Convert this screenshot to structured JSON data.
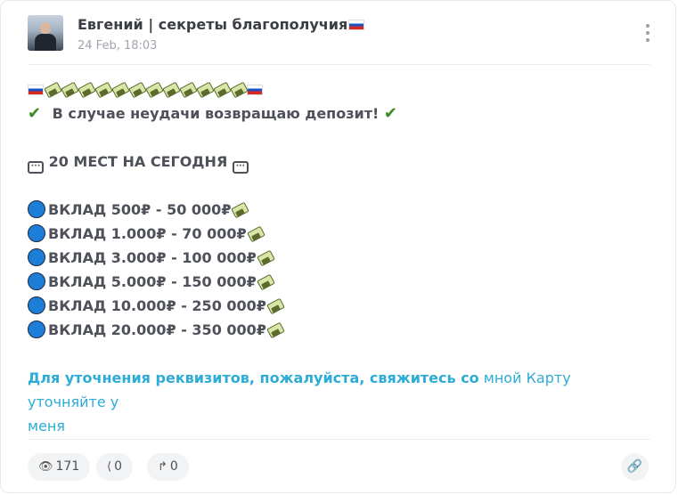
{
  "post": {
    "author": "Евгений | секреты благополучия",
    "date": "24 Feb, 18:03",
    "line_refund": "В случае неудачи возвращаю депозит!",
    "line_places": "20 МЕСТ НА СЕГОДНЯ",
    "deposits": [
      "ВКЛАД 500₽ - 50 000₽",
      "ВКЛАД 1.000₽ - 70 000₽",
      "ВКЛАД 3.000₽ - 100 000₽",
      "ВКЛАД 5.000₽ - 150 000₽",
      "ВКЛАД 10.000₽ - 250 000₽",
      "ВКЛАД 20.000₽ - 350 000₽"
    ],
    "contact_bold": "Для уточнения реквизитов, пожалуйста, свяжитесь со",
    "contact_normal_1": " мной Карту уточняйте у",
    "contact_normal_2": "меня"
  },
  "footer": {
    "views": "171",
    "shares": "0",
    "forwards": "0"
  },
  "colors": {
    "link": "#2dacd6",
    "text": "#4e5159",
    "pill_bg": "#f2f3f5"
  },
  "icons": [
    "russian-flag-icon",
    "money-wings-icon",
    "check-mark-icon",
    "speech-bubble-icon",
    "blue-circle-icon",
    "eye-icon",
    "share-icon",
    "forward-icon",
    "link-icon",
    "more-vertical-icon"
  ]
}
